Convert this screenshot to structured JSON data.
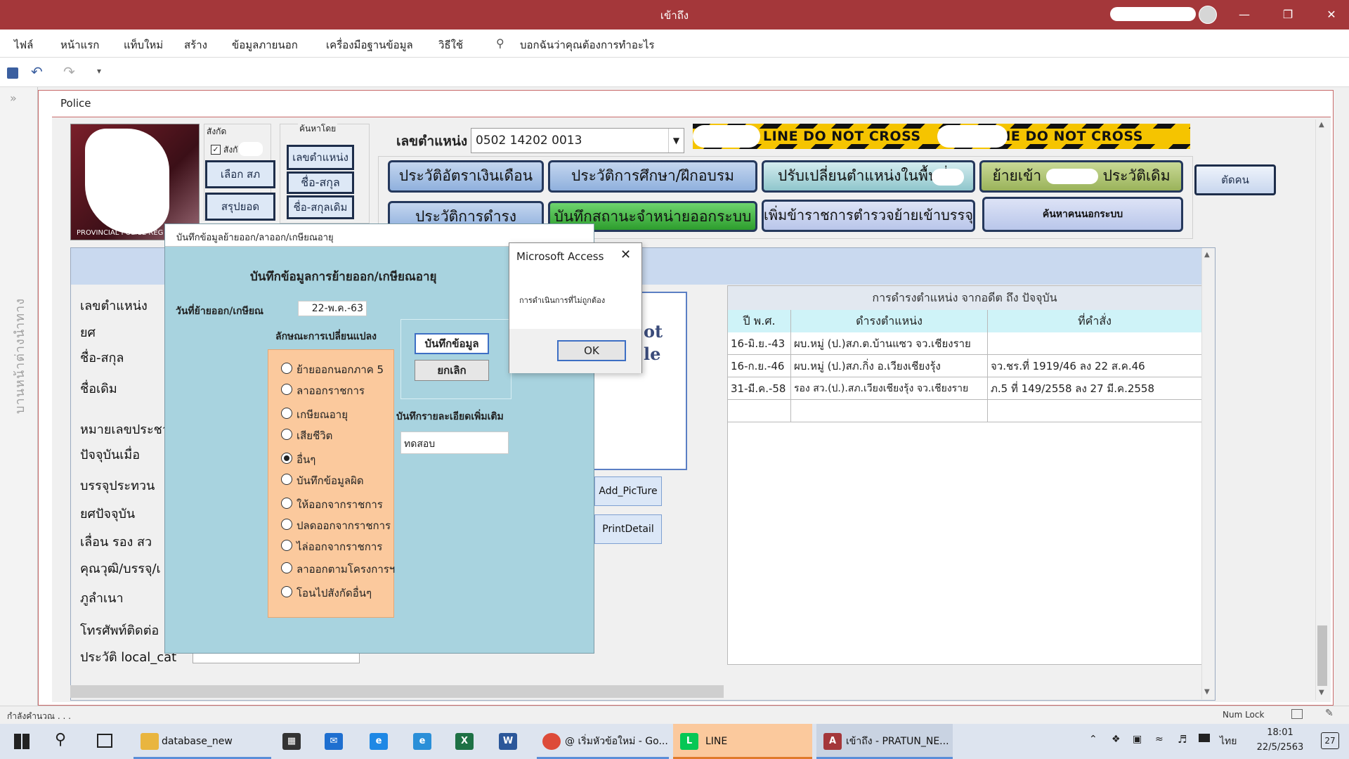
{
  "window": {
    "title": "เข้าถึง"
  },
  "ribbon": {
    "tabs": [
      "ไฟล์",
      "หน้าแรก",
      "แท็บใหม่",
      "สร้าง",
      "ข้อมูลภายนอก",
      "เครื่องมือฐานข้อมูล",
      "วิธีใช้"
    ],
    "tell_me": "บอกฉันว่าคุณต้องการทำอะไร"
  },
  "nav_pane": {
    "label": "บานหน้าต่างนำทาง"
  },
  "document": {
    "tab": "Police"
  },
  "form": {
    "photo_caption": "PROVINCIAL POLICE REG",
    "affiliation_label": "สังกัด",
    "affiliation_check": "สังกั",
    "select_button": "เลือก สภ",
    "summary_button": "สรุปยอด",
    "search_by_label": "ค้นหาโดย",
    "search_buttons": [
      "เลขตำแหน่ง",
      "ชื่อ-สกุล",
      "ชื่อ-สกุลเดิม"
    ],
    "position_no_label": "เลขตำแหน่ง",
    "position_no_value": "0502 14202 0013",
    "tape_text": "LINE DO NOT CROSS",
    "tape_text2": "E LINE DO NOT CROSS",
    "buttons_row1": [
      "ประวัติอัตราเงินเดือน",
      "ประวัติการศึกษา/ฝึกอบรม",
      "ปรับเปลี่ยนตำแหน่งในพื้นที่",
      "ย้ายเข้า",
      "ประวัติเดิม"
    ],
    "cut_button": "ตัดคน",
    "buttons_row2": [
      "ประวัติการดำรงตำแหน่ง",
      "บันทึกสถานะจำหน่ายออกระบบ",
      "เพิ่มข้าราชการตำรวจย้ายเข้าบรรจุ"
    ],
    "search_outside_button": "ค้นหาคนนอกระบบ",
    "field_labels": [
      "เลขตำแหน่ง",
      "ยศ",
      "ชื่อ-สกุล",
      "ชื่อเดิม",
      "หมายเลขประชา",
      "ปัจจุบันเมื่อ",
      "บรรจุประทวน",
      "ยศปัจจุบัน",
      "เลื่อน รอง สว",
      "คุณวุฒิ/บรรจุ/เ",
      "ภูลำเนา",
      "โทรศัพท์ติดต่อ",
      "ประวัติ local_cat"
    ],
    "image_text": [
      "ot",
      "le"
    ],
    "add_picture_button": "Add_PicTure",
    "print_detail_button": "PrintDetail"
  },
  "history_table": {
    "title": "การดำรงตำแหน่ง จากอดีต ถึง ปัจจุบัน",
    "columns": [
      "ปี พ.ศ.",
      "ดำรงตำแหน่ง",
      "ที่คำสั่ง"
    ],
    "rows": [
      [
        "16-มิ.ย.-43",
        "ผบ.หมู่ (ป.)สภ.ต.บ้านแซว จว.เชียงราย",
        ""
      ],
      [
        "16-ก.ย.-46",
        "ผบ.หมู่ (ป.)สภ.กิ่ง อ.เวียงเชียงรุ้ง",
        "จว.ชร.ที่ 1919/46 ลง 22 ส.ค.46"
      ],
      [
        "31-มี.ค.-58",
        "รอง สว.(ป.).สภ.เวียงเชียงรุ้ง จว.เชียงราย",
        "ภ.5 ที่ 149/2558 ลง 27 มี.ค.2558"
      ]
    ]
  },
  "popup": {
    "window_title": "บันทึกข้อมูลย้ายออก/ลาออก/เกษียณอายุ",
    "heading": "บันทึกข้อมูลการย้ายออก/เกษียณอายุ",
    "date_label": "วันที่ย้ายออก/เกษียณ",
    "date_value": "22-พ.ค.-63",
    "change_type_label": "ลักษณะการเปลี่ยนแปลง",
    "options": [
      "ย้ายออกนอกภาค 5",
      "ลาออกราชการ",
      "เกษียณอายุ",
      "เสียชีวิต",
      "อื่นๆ",
      "บันทึกข้อมูลผิด",
      "ให้ออกจากราชการ",
      "ปลดออกจากราชการ",
      "ไล่ออกจากราชการ",
      "ลาออกตามโครงการฯ",
      "โอนไปสังกัดอื่นๆ"
    ],
    "selected_option": "อื่นๆ",
    "save_button": "บันทึกข้อมูล",
    "cancel_button": "ยกเลิก",
    "detail_label": "บันทึกรายละเอียดเพิ่มเติม",
    "detail_value": "ทดสอบ"
  },
  "message_box": {
    "title": "Microsoft Access",
    "message": "การดำเนินการที่ไม่ถูกต้อง",
    "ok_button": "OK"
  },
  "status_bar": {
    "left": "กำลังคำนวณ . . .",
    "num_lock": "Num Lock"
  },
  "taskbar": {
    "items": [
      "database_new",
      "@ เริ่มหัวข้อใหม่ - Go...",
      "LINE",
      "เข้าถึง - PRATUN_NE..."
    ],
    "language": "ไทย",
    "time": "18:01",
    "date": "22/5/2563",
    "notification_count": "27"
  }
}
